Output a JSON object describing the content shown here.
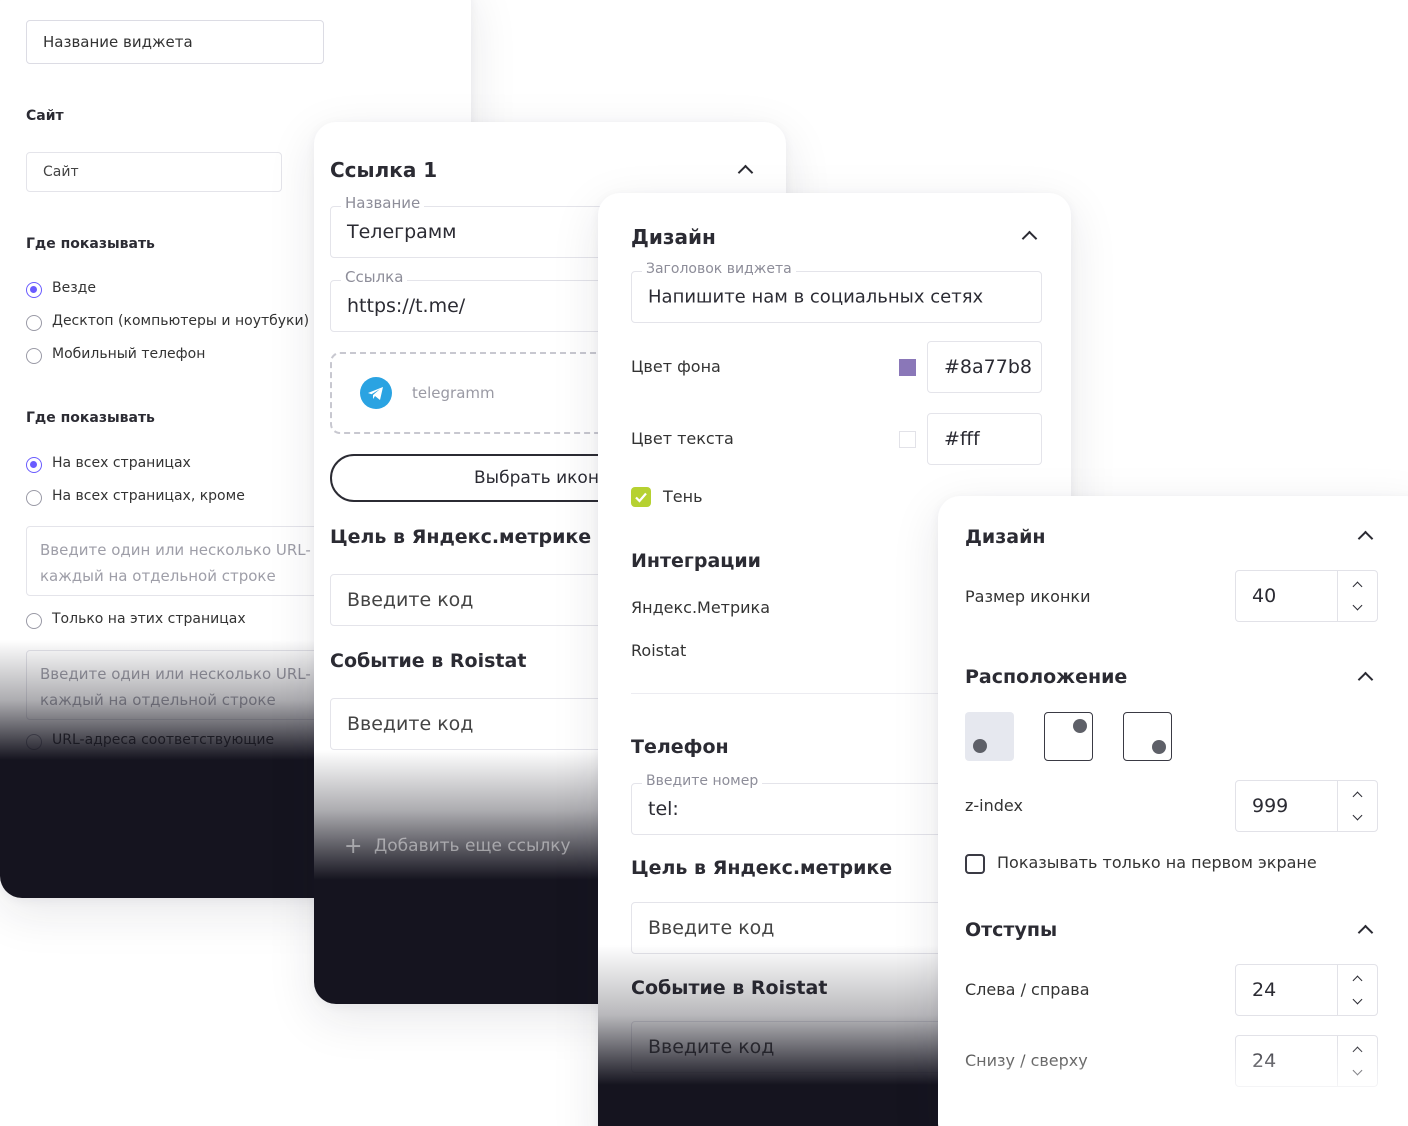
{
  "card1": {
    "widget_name_value": "Название виджета",
    "site_title": "Сайт",
    "site_value": "Сайт",
    "where_show_1": "Где показывать",
    "device_options": [
      "Везде",
      "Десктоп (компьютеры и ноутбуки)",
      "Мобильный телефон"
    ],
    "where_show_2": "Где показывать",
    "page_options": [
      "На всех страницах",
      "На всех страницах, кроме"
    ],
    "urls_placeholder_1": "Введите один или несколько URL-\nкаждый на отдельной строке",
    "only_these": "Только на этих страницах",
    "urls_placeholder_2": "Введите один или несколько URL-\nкаждый на отдельной строке",
    "urls_matching": "URL-адреса соответствующие"
  },
  "card2": {
    "title": "Ссылка 1",
    "name_legend": "Название",
    "name_value": "Телеграмм",
    "link_legend": "Ссылка",
    "link_value": "https://t.me/",
    "icon_label": "telegramm",
    "choose_icon": "Выбрать иконку",
    "goal_title": "Цель в Яндекс.метрике",
    "goal_placeholder": "Введите код",
    "event_title": "Событие в Roistat",
    "event_placeholder": "Введите код",
    "add_link": "Добавить еще ссылку"
  },
  "card3": {
    "design_title": "Дизайн",
    "header_legend": "Заголовок виджета",
    "header_value": "Напишите нам в социальных сетях",
    "bg_label": "Цвет фона",
    "bg_value": "#8a77b8",
    "text_label": "Цвет текста",
    "text_value": "#fff",
    "shadow_label": "Тень",
    "integrations_title": "Интеграции",
    "yandex": "Яндекс.Метрика",
    "roistat": "Roistat",
    "phone_title": "Телефон",
    "phone_legend": "Введите номер",
    "phone_value": "tel:",
    "goal_title": "Цель в Яндекс.метрике",
    "goal_placeholder": "Введите код",
    "event_title": "Событие в Roistat",
    "event_placeholder": "Введите код"
  },
  "card4": {
    "design_title": "Дизайн",
    "icon_size_label": "Размер иконки",
    "icon_size_value": "40",
    "position_title": "Расположение",
    "zindex_label": "z-index",
    "zindex_value": "999",
    "first_screen_label": "Показывать только на первом экране",
    "margins_title": "Отступы",
    "left_right_label": "Слева / справа",
    "left_right_value": "24",
    "bottom_top_label": "Снизу / сверху",
    "bottom_top_value": "24"
  },
  "colors": {
    "accent": "#6a5cff",
    "swatch_bg": "#8a77b8",
    "telegram": "#2aa3e2",
    "shadow_check": "#b6d131",
    "dark": "#15141f"
  }
}
